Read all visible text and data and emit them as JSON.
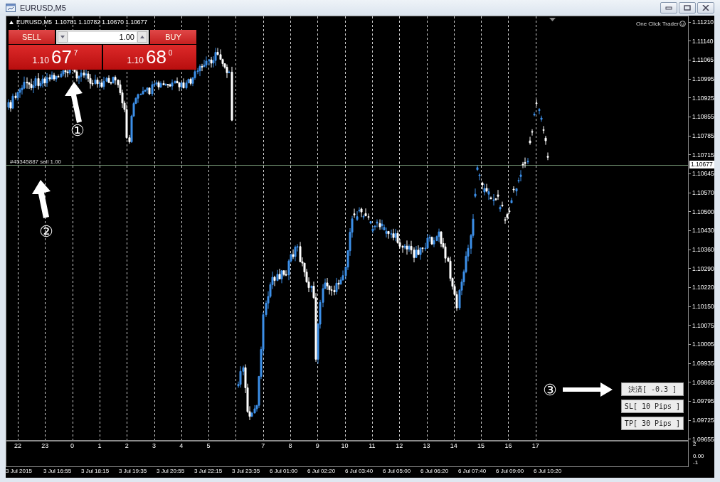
{
  "window": {
    "title": "EURUSD,M5"
  },
  "chart": {
    "header": {
      "symbol": "EURUSD,M5",
      "ohlc": "1.10781 1.10782 1.10670 1.10677"
    },
    "one_click_trader": "One Click Trader",
    "trade_panel": {
      "sell_label": "SELL",
      "buy_label": "BUY",
      "lot_value": "1.00",
      "sell_price": {
        "prefix": "1.10",
        "big": "67",
        "small": "7"
      },
      "buy_price": {
        "prefix": "1.10",
        "big": "68",
        "small": "0"
      }
    },
    "position_line": {
      "label": "#45345887 sell 1.00"
    },
    "current_price": "1.10677",
    "price_axis": [
      "1.11210",
      "1.11140",
      "1.11065",
      "1.10995",
      "1.10925",
      "1.10855",
      "1.10785",
      "1.10715",
      "1.10645",
      "1.10570",
      "1.10500",
      "1.10430",
      "1.10360",
      "1.10290",
      "1.10220",
      "1.10150",
      "1.10075",
      "1.10005",
      "1.09935",
      "1.09865",
      "1.09795",
      "1.09725",
      "1.09655"
    ],
    "hour_labels": [
      "22",
      "23",
      "0",
      "1",
      "2",
      "3",
      "4",
      "5",
      "7",
      "8",
      "9",
      "10",
      "11",
      "12",
      "13",
      "14",
      "15",
      "16",
      "17"
    ],
    "indicator_axis": [
      "2",
      "0.00",
      "-1"
    ],
    "time_axis": [
      "3 Jul 2015",
      "3 Jul 16:55",
      "3 Jul 18:15",
      "3 Jul 19:35",
      "3 Jul 20:55",
      "3 Jul 22:15",
      "3 Jul 23:35",
      "6 Jul 01:00",
      "6 Jul 02:20",
      "6 Jul 03:40",
      "6 Jul 05:00",
      "6 Jul 06:20",
      "6 Jul 07:40",
      "6 Jul 09:00",
      "6 Jul 10:20"
    ],
    "action_buttons": [
      "決済[ -0.3 ]",
      "SL[ 10 Pips ]",
      "TP[ 30 Pips ]"
    ],
    "annotations": [
      "①",
      "②",
      "③"
    ]
  }
}
